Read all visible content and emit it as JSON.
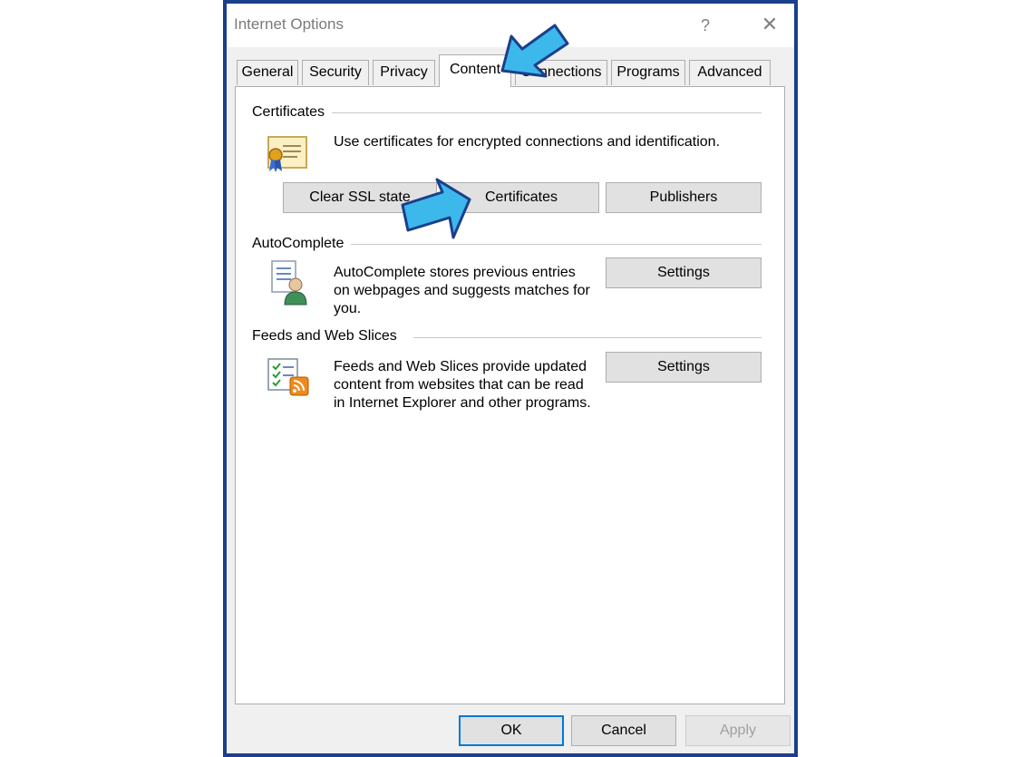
{
  "window": {
    "title": "Internet Options",
    "help_label": "?",
    "close_label": "✕"
  },
  "tabs": [
    {
      "label": "General"
    },
    {
      "label": "Security"
    },
    {
      "label": "Privacy"
    },
    {
      "label": "Content",
      "selected": true
    },
    {
      "label": "Connections"
    },
    {
      "label": "Programs"
    },
    {
      "label": "Advanced"
    }
  ],
  "certificates": {
    "title": "Certificates",
    "description": "Use certificates for encrypted connections and identification.",
    "icon": "certificate-icon",
    "buttons": {
      "clear_ssl": "Clear SSL state",
      "certificates": "Certificates",
      "publishers": "Publishers"
    }
  },
  "autocomplete": {
    "title": "AutoComplete",
    "description_lines": [
      "AutoComplete stores previous entries",
      "on webpages and suggests matches for",
      "you."
    ],
    "icon": "autocomplete-icon",
    "settings_label": "Settings"
  },
  "feeds": {
    "title": "Feeds and Web Slices",
    "description_lines": [
      "Feeds and Web Slices provide updated",
      "content from websites that can be read",
      "in Internet Explorer and other programs."
    ],
    "icon": "rss-feed-icon",
    "settings_label": "Settings"
  },
  "footer": {
    "ok": "OK",
    "cancel": "Cancel",
    "apply": "Apply"
  },
  "colors": {
    "window_border": "#1b3f8b",
    "annotation_arrow": "#3db8ea",
    "annotation_arrow_outline": "#1b3f8b"
  }
}
